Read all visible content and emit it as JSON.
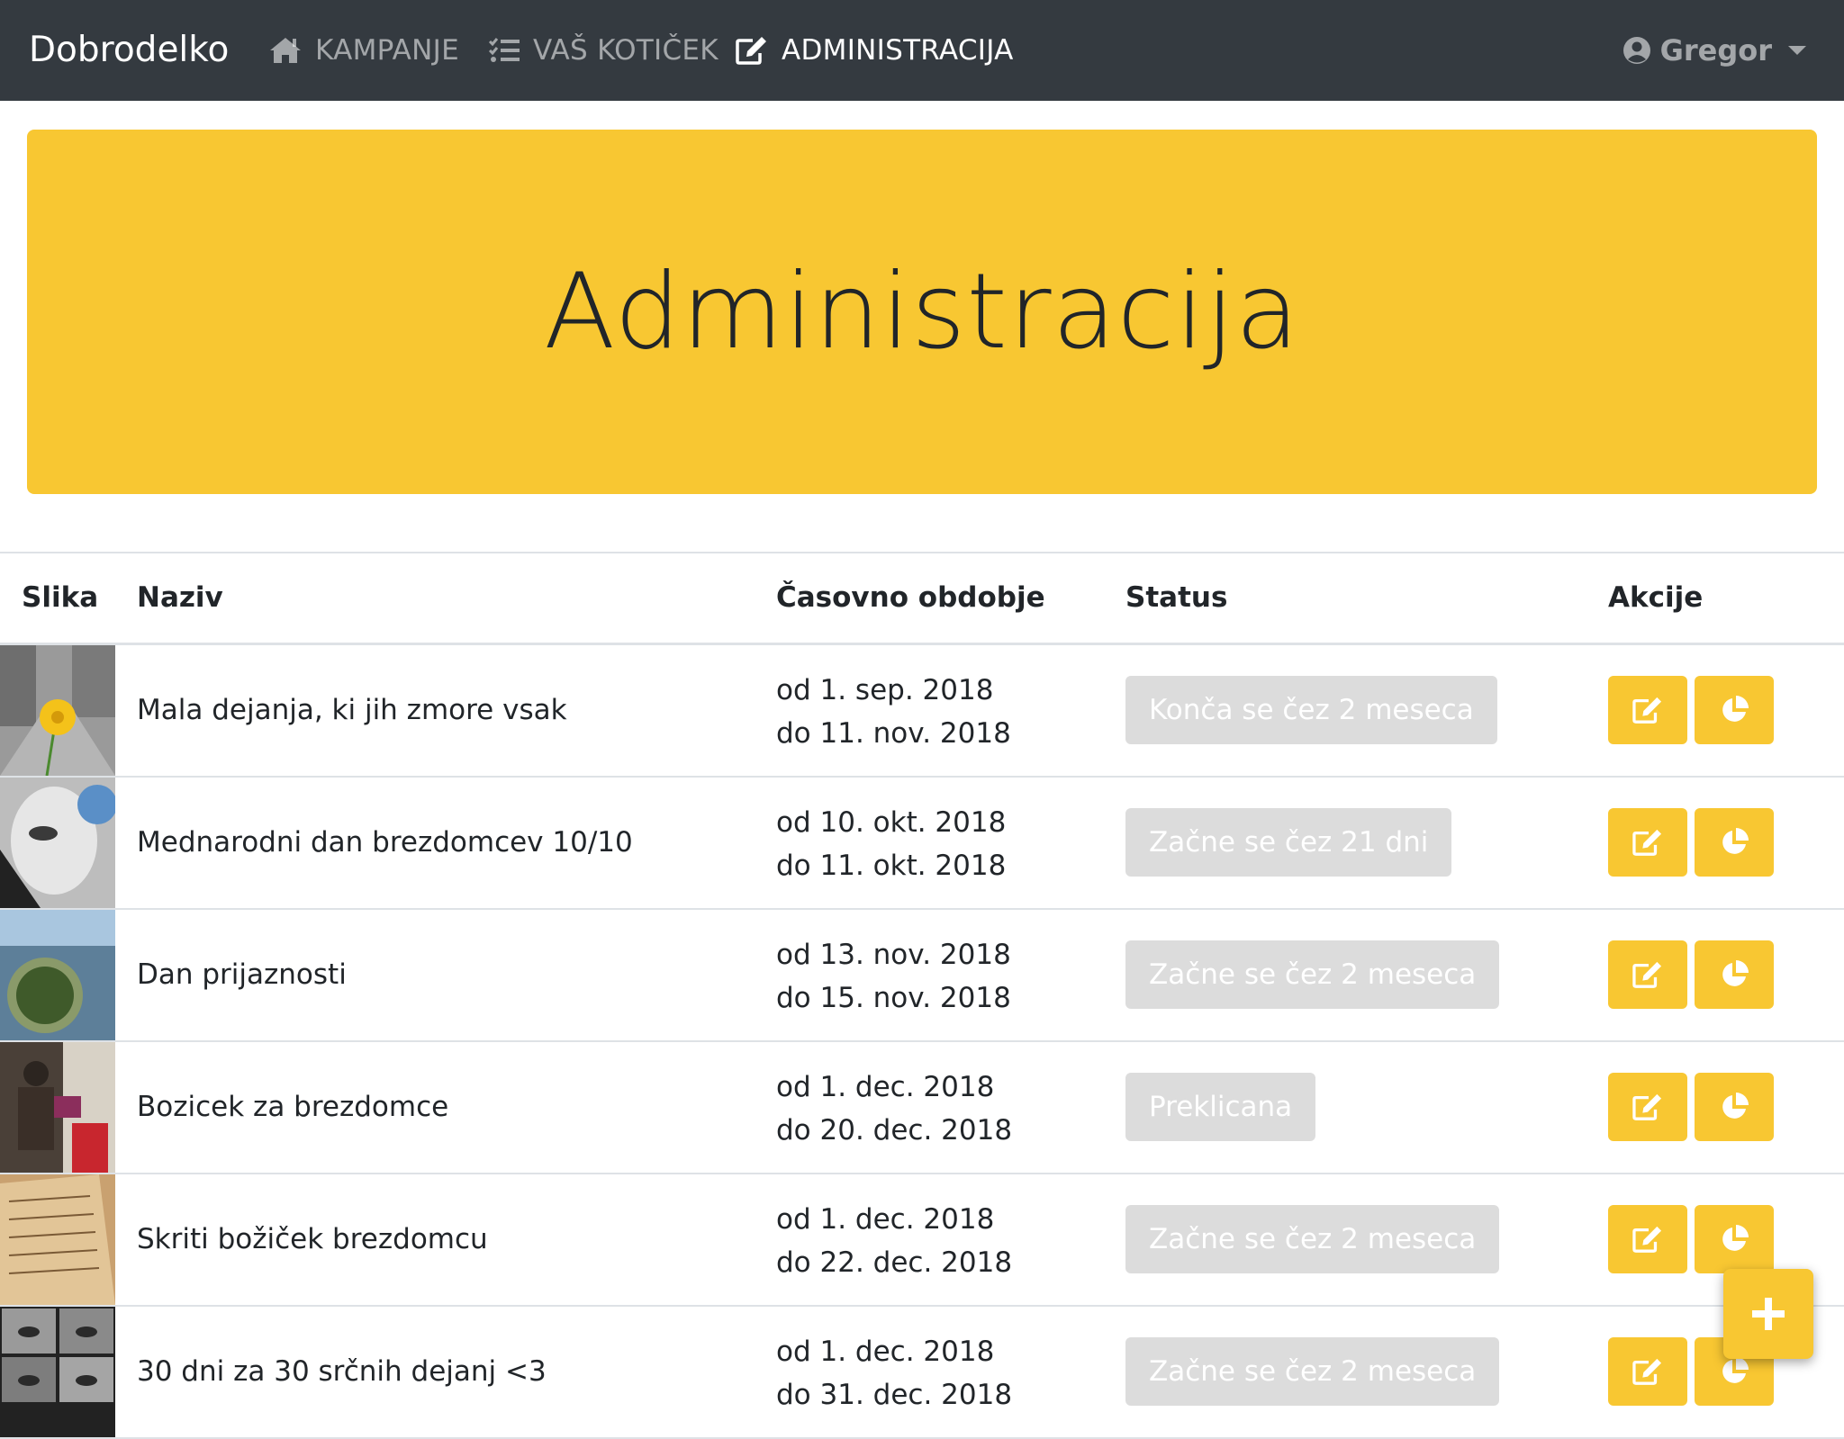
{
  "navbar": {
    "brand": "Dobrodelko",
    "items": [
      {
        "label": "KAMPANJE",
        "icon": "home-icon"
      },
      {
        "label": "VAŠ KOTIČEK",
        "icon": "tasks-icon"
      },
      {
        "label": "ADMINISTRACIJA",
        "icon": "edit-icon",
        "active": true
      }
    ],
    "user": "Gregor"
  },
  "jumbotron": {
    "title": "Administracija"
  },
  "table": {
    "headers": [
      "Slika",
      "Naziv",
      "Časovno obdobje",
      "Status",
      "Akcije"
    ],
    "rows": [
      {
        "name": "Mala dejanja, ki jih zmore vsak",
        "from": "od 1. sep. 2018",
        "to": "do 11. nov. 2018",
        "status": "Konča se čez 2 meseca"
      },
      {
        "name": "Mednarodni dan brezdomcev 10/10",
        "from": "od 10. okt. 2018",
        "to": "do 11. okt. 2018",
        "status": "Začne se čez 21 dni"
      },
      {
        "name": "Dan prijaznosti",
        "from": "od 13. nov. 2018",
        "to": "do 15. nov. 2018",
        "status": "Začne se čez 2 meseca"
      },
      {
        "name": "Bozicek za brezdomce",
        "from": "od 1. dec. 2018",
        "to": "do 20. dec. 2018",
        "status": "Preklicana"
      },
      {
        "name": "Skriti božiček brezdomcu",
        "from": "od 1. dec. 2018",
        "to": "do 22. dec. 2018",
        "status": "Začne se čez 2 meseca"
      },
      {
        "name": "30 dni za 30 srčnih dejanj <3",
        "from": "od 1. dec. 2018",
        "to": "do 31. dec. 2018",
        "status": "Začne se čez 2 meseca"
      }
    ]
  },
  "colors": {
    "navbar": "#343a40",
    "accent": "#f8c732",
    "badge": "#dcdcdc"
  }
}
